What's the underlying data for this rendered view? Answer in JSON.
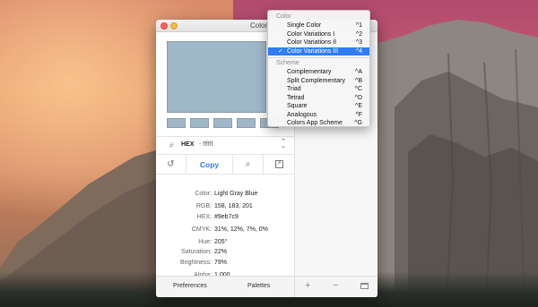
{
  "window": {
    "title": "Color"
  },
  "hex_row": {
    "hash": "#",
    "format": "HEX",
    "value": "- ffffff",
    "stepper": "⌃⌄"
  },
  "toolbar": {
    "copy_label": "Copy",
    "history_icon": "↺",
    "pick_icon": "⌕",
    "expand_icon": "↗"
  },
  "info": [
    {
      "key": "Color:",
      "value": "Light Gray Blue"
    },
    {
      "key": "RGB:",
      "value": "158, 183, 201"
    },
    {
      "key": "HEX:",
      "value": "#9eb7c9"
    },
    {
      "key": "CMYK:",
      "value": "31%, 12%, 7%, 0%"
    },
    {
      "key": "Hue:",
      "value": "205°"
    },
    {
      "key": "Saturation:",
      "value": "22%"
    },
    {
      "key": "Brightness:",
      "value": "79%"
    },
    {
      "key": "Alpha:",
      "value": "1.000"
    }
  ],
  "footer": {
    "preferences": "Preferences",
    "palettes": "Palettes",
    "plus": "+",
    "minus": "−"
  },
  "menu": {
    "color_header": "Color",
    "color_items": [
      {
        "label": "Single Color",
        "shortcut": "^1",
        "checked": false
      },
      {
        "label": "Color Variations I",
        "shortcut": "^2",
        "checked": false
      },
      {
        "label": "Color Variations II",
        "shortcut": "^3",
        "checked": false
      },
      {
        "label": "Color Variations III",
        "shortcut": "^4",
        "checked": true
      }
    ],
    "scheme_header": "Scheme",
    "scheme_items": [
      {
        "label": "Complementary",
        "shortcut": "^A"
      },
      {
        "label": "Split Complementary",
        "shortcut": "^B"
      },
      {
        "label": "Triad",
        "shortcut": "^C"
      },
      {
        "label": "Tetrad",
        "shortcut": "^D"
      },
      {
        "label": "Square",
        "shortcut": "^E"
      },
      {
        "label": "Analogous",
        "shortcut": "^F"
      },
      {
        "label": "Colors App Scheme",
        "shortcut": "^G"
      }
    ],
    "check_mark": "✓"
  },
  "colors": {
    "preview": "#9eb7c9",
    "swatch": "#9eb7c9",
    "accent": "#2f7cf6"
  }
}
